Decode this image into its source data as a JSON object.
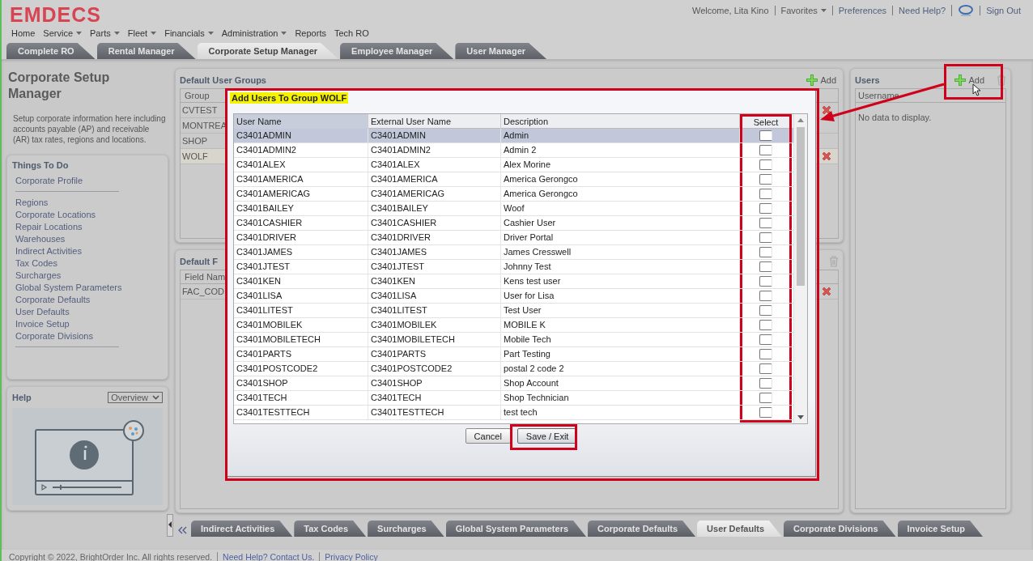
{
  "header": {
    "logo": "EMDECS",
    "user_links": [
      {
        "kind": "text",
        "label": "Welcome, Lita Kino"
      },
      {
        "kind": "menu",
        "label": "Favorites"
      },
      {
        "kind": "link",
        "label": "Preferences"
      },
      {
        "kind": "link",
        "label": "Need Help?"
      },
      {
        "kind": "chat"
      },
      {
        "kind": "link",
        "label": "Sign Out"
      }
    ]
  },
  "nav": [
    {
      "label": "Home",
      "has_menu": false
    },
    {
      "label": "Service",
      "has_menu": true
    },
    {
      "label": "Parts",
      "has_menu": true
    },
    {
      "label": "Fleet",
      "has_menu": true
    },
    {
      "label": "Financials",
      "has_menu": true
    },
    {
      "label": "Administration",
      "has_menu": true
    },
    {
      "label": "Reports",
      "has_menu": false
    },
    {
      "label": "Tech RO",
      "has_menu": false
    }
  ],
  "app_tabs": [
    {
      "label": "Complete RO",
      "selected": false
    },
    {
      "label": "Rental Manager",
      "selected": false
    },
    {
      "label": "Corporate Setup Manager",
      "selected": true
    },
    {
      "label": "Employee Manager",
      "selected": false
    },
    {
      "label": "User Manager",
      "selected": false
    }
  ],
  "sidebar": {
    "title": "Corporate Setup Manager",
    "description": "Setup corporate information here including accounts payable (AP) and receivable (AR) tax rates, regions and locations.",
    "things_to_do": {
      "title": "Things To Do",
      "groups": [
        [
          "Corporate Profile"
        ],
        [
          "Regions",
          "Corporate Locations",
          "Repair Locations",
          "Warehouses",
          "Indirect Activities",
          "Tax Codes",
          "Surcharges",
          "Global System Parameters",
          "Corporate Defaults",
          "User Defaults",
          "Invoice Setup",
          "Corporate Divisions"
        ]
      ]
    },
    "help": {
      "title": "Help",
      "dropdown": "Overview"
    }
  },
  "groups_panel": {
    "title": "Default User Groups",
    "add_label": "Add",
    "column": "Group",
    "rows": [
      {
        "group": "CVTEST",
        "selected": false,
        "deletable": true
      },
      {
        "group": "MONTREA",
        "selected": false,
        "deletable": false
      },
      {
        "group": "SHOP",
        "selected": false,
        "deletable": false
      },
      {
        "group": "WOLF",
        "selected": true,
        "deletable": true
      }
    ]
  },
  "fields_panel": {
    "title": "Default F",
    "column": "Field Nam",
    "rows": [
      {
        "field": "FAC_COD",
        "deletable": true
      }
    ]
  },
  "users_panel": {
    "title": "Users",
    "add_label": "Add",
    "column": "Username",
    "empty_text": "No data to display."
  },
  "modal": {
    "title": "Add Users To Group WOLF",
    "columns": [
      {
        "label": "User Name",
        "sorted": true
      },
      {
        "label": "External User Name",
        "sorted": false
      },
      {
        "label": "Description",
        "sorted": false
      },
      {
        "label": "Select",
        "sorted": false
      }
    ],
    "rows": [
      {
        "user": "C3401ADMIN",
        "external": "C3401ADMIN",
        "description": "Admin",
        "selected": true,
        "checked": false
      },
      {
        "user": "C3401ADMIN2",
        "external": "C3401ADMIN2",
        "description": "Admin 2",
        "selected": false,
        "checked": false
      },
      {
        "user": "C3401ALEX",
        "external": "C3401ALEX",
        "description": "Alex Morine",
        "selected": false,
        "checked": false
      },
      {
        "user": "C3401AMERICA",
        "external": "C3401AMERICA",
        "description": "America Gerongco",
        "selected": false,
        "checked": false
      },
      {
        "user": "C3401AMERICAG",
        "external": "C3401AMERICAG",
        "description": "America Gerongco",
        "selected": false,
        "checked": false
      },
      {
        "user": "C3401BAILEY",
        "external": "C3401BAILEY",
        "description": "Woof",
        "selected": false,
        "checked": false
      },
      {
        "user": "C3401CASHIER",
        "external": "C3401CASHIER",
        "description": "Cashier User",
        "selected": false,
        "checked": false
      },
      {
        "user": "C3401DRIVER",
        "external": "C3401DRIVER",
        "description": "Driver Portal",
        "selected": false,
        "checked": false
      },
      {
        "user": "C3401JAMES",
        "external": "C3401JAMES",
        "description": "James Cresswell",
        "selected": false,
        "checked": false
      },
      {
        "user": "C3401JTEST",
        "external": "C3401JTEST",
        "description": "Johnny Test",
        "selected": false,
        "checked": false
      },
      {
        "user": "C3401KEN",
        "external": "C3401KEN",
        "description": "Kens test user",
        "selected": false,
        "checked": false
      },
      {
        "user": "C3401LISA",
        "external": "C3401LISA",
        "description": "User for Lisa",
        "selected": false,
        "checked": false
      },
      {
        "user": "C3401LITEST",
        "external": "C3401LITEST",
        "description": "Test User",
        "selected": false,
        "checked": false
      },
      {
        "user": "C3401MOBILEK",
        "external": "C3401MOBILEK",
        "description": "MOBILE K",
        "selected": false,
        "checked": false
      },
      {
        "user": "C3401MOBILETECH",
        "external": "C3401MOBILETECH",
        "description": "Mobile Tech",
        "selected": false,
        "checked": false
      },
      {
        "user": "C3401PARTS",
        "external": "C3401PARTS",
        "description": "Part Testing",
        "selected": false,
        "checked": false
      },
      {
        "user": "C3401POSTCODE2",
        "external": "C3401POSTCODE2",
        "description": "postal 2 code 2",
        "selected": false,
        "checked": false
      },
      {
        "user": "C3401SHOP",
        "external": "C3401SHOP",
        "description": "Shop Account",
        "selected": false,
        "checked": false
      },
      {
        "user": "C3401TECH",
        "external": "C3401TECH",
        "description": "Shop Technician",
        "selected": false,
        "checked": false
      },
      {
        "user": "C3401TESTTECH",
        "external": "C3401TESTTECH",
        "description": "test tech",
        "selected": false,
        "checked": false
      }
    ],
    "buttons": [
      {
        "label": "Cancel",
        "kind": "secondary"
      },
      {
        "label": "Save / Exit",
        "kind": "primary"
      }
    ]
  },
  "section_tabs": [
    {
      "label": "Indirect Activities",
      "selected": false
    },
    {
      "label": "Tax Codes",
      "selected": false
    },
    {
      "label": "Surcharges",
      "selected": false
    },
    {
      "label": "Global System Parameters",
      "selected": false
    },
    {
      "label": "Corporate Defaults",
      "selected": false
    },
    {
      "label": "User Defaults",
      "selected": true
    },
    {
      "label": "Corporate Divisions",
      "selected": false
    },
    {
      "label": "Invoice Setup",
      "selected": false
    }
  ],
  "footer": {
    "copyright": "Copyright © 2022, BrightOrder Inc. All rights reserved.",
    "links": [
      "Need Help? Contact Us.",
      "Privacy Policy"
    ]
  }
}
